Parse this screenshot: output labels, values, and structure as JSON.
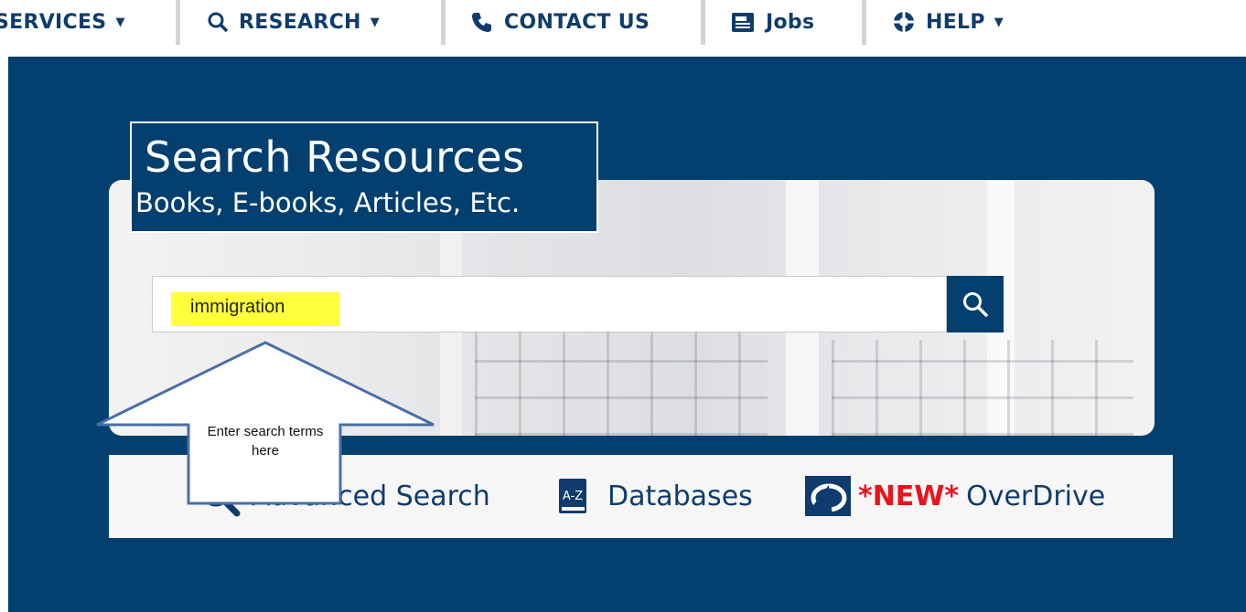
{
  "nav": {
    "items": [
      {
        "label": "SERVICES",
        "icon": "none"
      },
      {
        "label": "RESEARCH",
        "icon": "search-icon"
      },
      {
        "label": "CONTACT US",
        "icon": "phone-icon"
      },
      {
        "label": "Jobs",
        "icon": "jobs-icon"
      },
      {
        "label": "HELP",
        "icon": "lifebuoy-icon"
      }
    ]
  },
  "hero": {
    "title": "Search Resources",
    "subtitle": "Books, E-books, Articles, Etc."
  },
  "search": {
    "value": "immigration",
    "button_icon": "search-icon"
  },
  "links": {
    "advanced": "Advanced Search",
    "databases": "Databases",
    "databases_badge": "A-Z",
    "overdrive_new": "*NEW*",
    "overdrive": "OverDrive"
  },
  "annotation": {
    "text": "Enter search terms here"
  },
  "colors": {
    "brand_blue": "#04406f",
    "highlight": "#ffff3c",
    "new_red": "#e8141c",
    "callout_stroke": "#4a6fa5"
  }
}
